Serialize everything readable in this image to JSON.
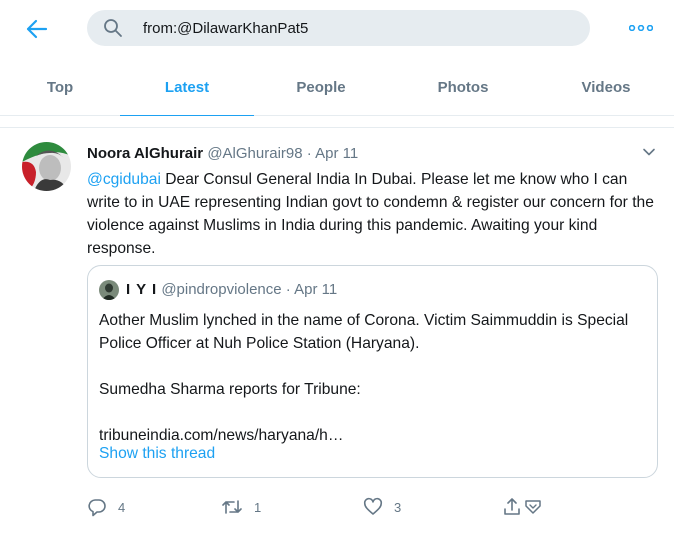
{
  "search": {
    "query": "from:@DilawarKhanPat5"
  },
  "tabs": [
    {
      "label": "Top",
      "active": false
    },
    {
      "label": "Latest",
      "active": true
    },
    {
      "label": "People",
      "active": false
    },
    {
      "label": "Photos",
      "active": false
    },
    {
      "label": "Videos",
      "active": false
    }
  ],
  "tweet": {
    "author_name": "Noora AlGhurair",
    "author_handle": "@AlGhurair98",
    "separator": "·",
    "date": "Apr 11",
    "mention": "@cgidubai",
    "text": " Dear Consul General India In Dubai. Please let me know who I can write to in UAE representing Indian govt to condemn & register our concern for the violence against Muslims in India during this pandemic. Awaiting your kind response.",
    "replies": "4",
    "retweets": "1",
    "likes": "3"
  },
  "quote": {
    "author_name": "I Y I",
    "author_handle": "@pindropviolence",
    "separator": "·",
    "date": "Apr 11",
    "line1": "Aother Muslim lynched in the name of Corona. Victim Saimmuddin is Special Police Officer at Nuh Police Station (Haryana).",
    "line2": "Sumedha Sharma reports for Tribune:",
    "line3": "tribuneindia.com/news/haryana/h…",
    "show_thread": "Show this thread"
  },
  "icons": {
    "back": "back-arrow-icon",
    "search": "search-icon",
    "more": "more-dots-icon",
    "caret": "chevron-down-icon",
    "reply": "reply-icon",
    "retweet": "retweet-icon",
    "like": "heart-icon",
    "share": "share-icon"
  },
  "colors": {
    "accent": "#1da1f2",
    "secondary_text": "#657786",
    "search_bg": "#e6ecf0",
    "border": "#ccd6dd"
  }
}
